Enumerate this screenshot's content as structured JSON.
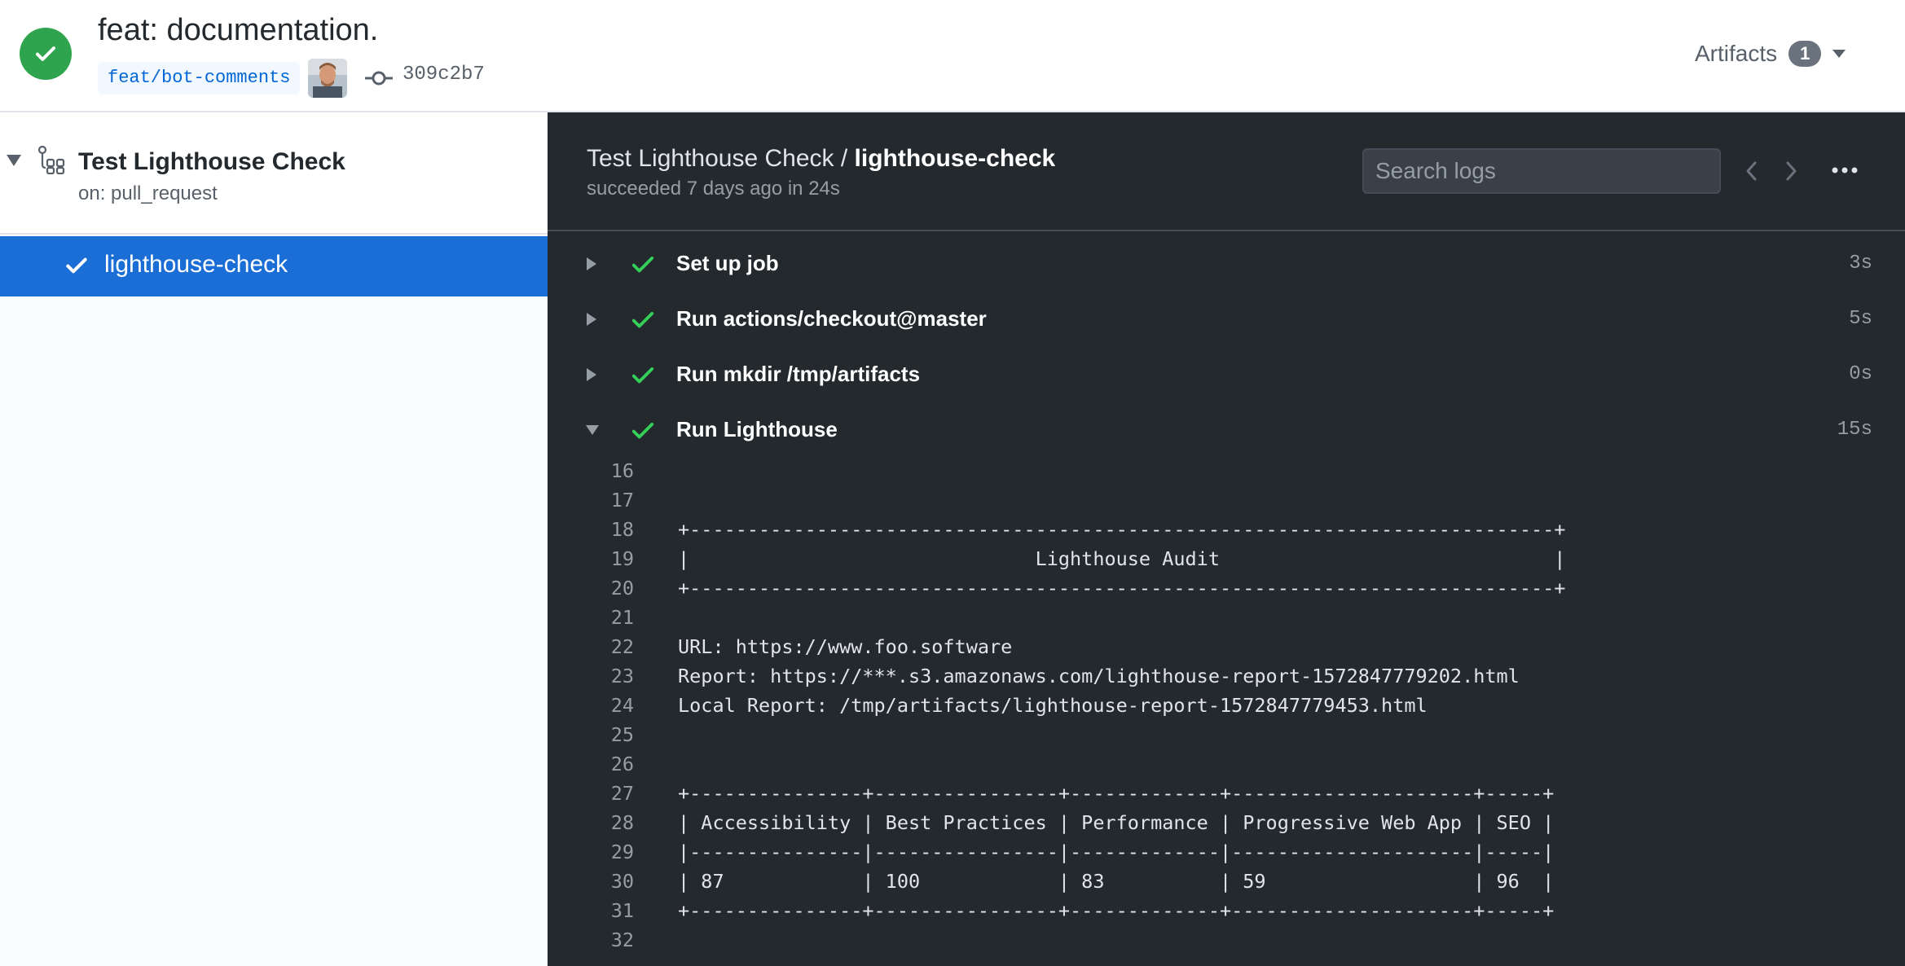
{
  "header": {
    "title": "feat: documentation.",
    "branch": "feat/bot-comments",
    "commit_sha": "309c2b7",
    "artifacts_label": "Artifacts",
    "artifacts_count": "1",
    "status_color": "#2ea44f"
  },
  "sidebar": {
    "workflow_name": "Test Lighthouse Check",
    "workflow_trigger": "on: pull_request",
    "jobs": [
      {
        "label": "lighthouse-check",
        "selected": true
      }
    ],
    "selected_color": "#1b6ed6"
  },
  "log": {
    "workflow_prefix": "Test Lighthouse Check / ",
    "job_name": "lighthouse-check",
    "subtitle": "succeeded 7 days ago in 24s",
    "search_placeholder": "Search logs",
    "steps": [
      {
        "name": "Set up job",
        "duration": "3s",
        "expanded": false
      },
      {
        "name": "Run actions/checkout@master",
        "duration": "5s",
        "expanded": false
      },
      {
        "name": "Run mkdir /tmp/artifacts",
        "duration": "0s",
        "expanded": false
      },
      {
        "name": "Run Lighthouse",
        "duration": "15s",
        "expanded": true
      }
    ],
    "lines": [
      {
        "n": "16",
        "text": ""
      },
      {
        "n": "17",
        "text": ""
      },
      {
        "n": "18",
        "text": "+---------------------------------------------------------------------------+"
      },
      {
        "n": "19",
        "text": "|                              Lighthouse Audit                             |"
      },
      {
        "n": "20",
        "text": "+---------------------------------------------------------------------------+"
      },
      {
        "n": "21",
        "text": ""
      },
      {
        "n": "22",
        "text": "URL: https://www.foo.software"
      },
      {
        "n": "23",
        "text": "Report: https://***.s3.amazonaws.com/lighthouse-report-1572847779202.html"
      },
      {
        "n": "24",
        "text": "Local Report: /tmp/artifacts/lighthouse-report-1572847779453.html"
      },
      {
        "n": "25",
        "text": ""
      },
      {
        "n": "26",
        "text": ""
      },
      {
        "n": "27",
        "text": "+---------------+----------------+-------------+---------------------+-----+"
      },
      {
        "n": "28",
        "text": "| Accessibility | Best Practices | Performance | Progressive Web App | SEO |"
      },
      {
        "n": "29",
        "text": "|---------------|----------------|-------------|---------------------|-----|"
      },
      {
        "n": "30",
        "text": "| 87            | 100            | 83          | 59                  | 96  |"
      },
      {
        "n": "31",
        "text": "+---------------+----------------+-------------+---------------------+-----+"
      },
      {
        "n": "32",
        "text": ""
      }
    ]
  }
}
